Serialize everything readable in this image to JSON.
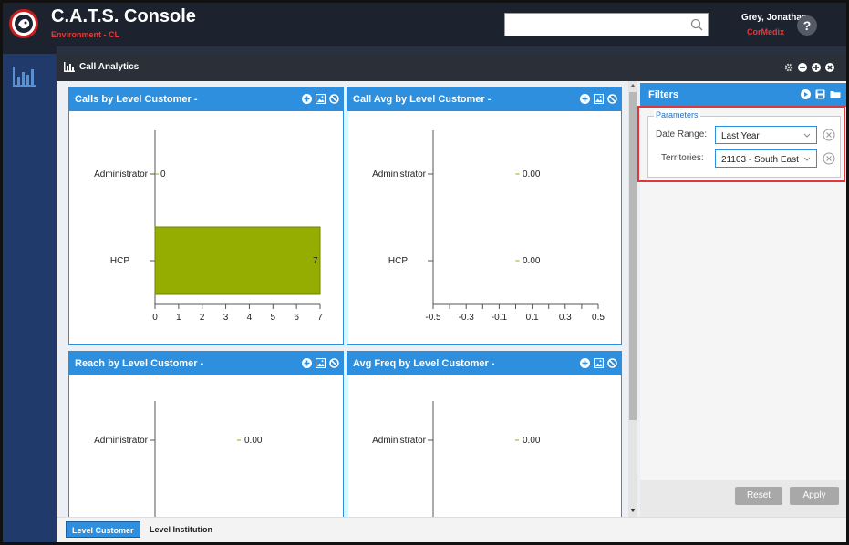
{
  "app": {
    "title": "C.A.T.S. Console",
    "environment": "Environment - CL"
  },
  "search": {
    "value": "",
    "placeholder": ""
  },
  "user": {
    "name": "Grey, Jonathan",
    "org": "CorMedix"
  },
  "help": {
    "label": "?"
  },
  "workspace": {
    "title": "Call Analytics"
  },
  "panels": [
    {
      "title": "Calls by Level Customer -"
    },
    {
      "title": "Call Avg by Level Customer -"
    },
    {
      "title": "Reach by Level Customer -"
    },
    {
      "title": "Avg Freq by Level Customer -"
    }
  ],
  "filters": {
    "title": "Filters",
    "legend": "Parameters",
    "date_range_label": "Date Range:",
    "date_range_value": "Last Year",
    "territories_label": "Territories:",
    "territories_value": "21103 - South East",
    "reset_label": "Reset",
    "apply_label": "Apply"
  },
  "tabs": [
    {
      "label": "Level Customer",
      "active": true
    },
    {
      "label": "Level Institution",
      "active": false
    }
  ],
  "colors": {
    "bar": "#94ad00",
    "accent": "#2d8fdd",
    "highlight": "#e0373d"
  },
  "chart_data": [
    {
      "type": "bar",
      "orientation": "horizontal",
      "categories": [
        "Administrator",
        "HCP"
      ],
      "values": [
        0,
        7
      ],
      "data_labels": [
        "0",
        "7"
      ],
      "xlim": [
        0,
        7
      ],
      "xticks": [
        "0",
        "1",
        "2",
        "3",
        "4",
        "5",
        "6",
        "7"
      ]
    },
    {
      "type": "bar",
      "orientation": "horizontal",
      "categories": [
        "Administrator",
        "HCP"
      ],
      "values": [
        0,
        0
      ],
      "data_labels": [
        "0.00",
        "0.00"
      ],
      "xlim": [
        -0.5,
        0.5
      ],
      "xticks": [
        "-0.5",
        "-0.3",
        "-0.1",
        "0.1",
        "0.3",
        "0.5"
      ]
    },
    {
      "type": "bar",
      "orientation": "horizontal",
      "categories": [
        "Administrator"
      ],
      "values": [
        0
      ],
      "data_labels": [
        "0.00"
      ]
    },
    {
      "type": "bar",
      "orientation": "horizontal",
      "categories": [
        "Administrator"
      ],
      "values": [
        0
      ],
      "data_labels": [
        "0.00"
      ]
    }
  ]
}
